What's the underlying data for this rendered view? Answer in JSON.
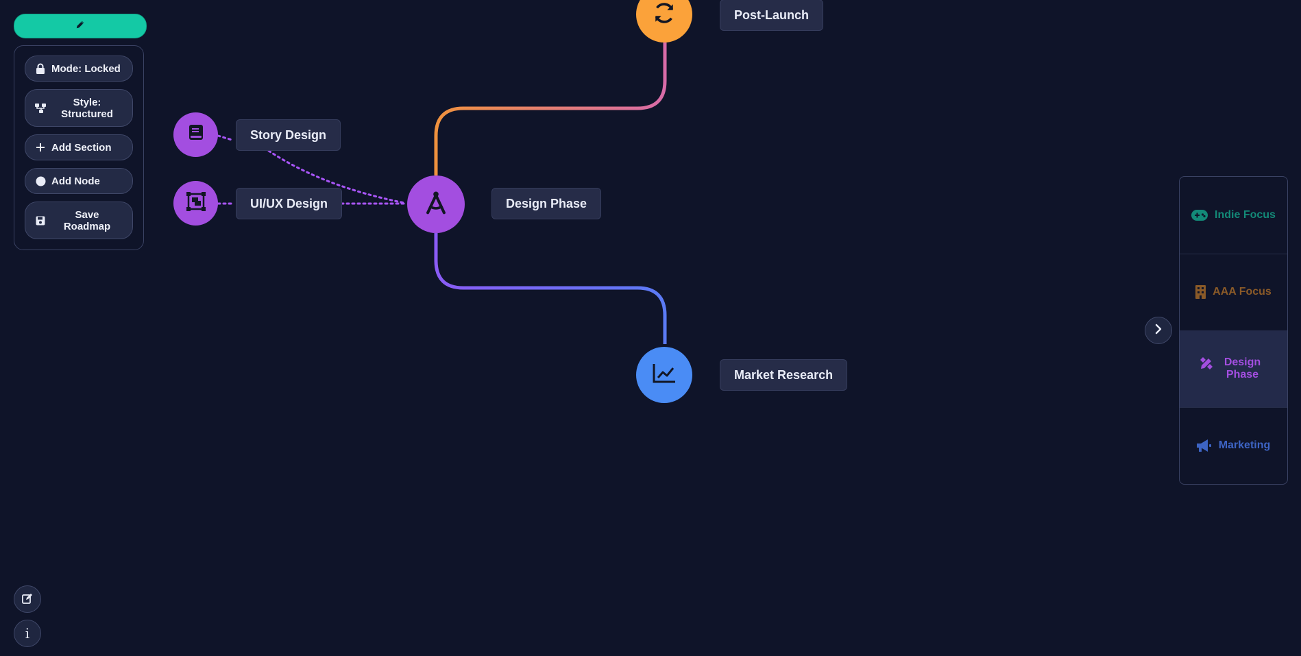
{
  "toolbar": {
    "edit_icon": "pencil-icon",
    "accent": "#14c9a5",
    "buttons": [
      {
        "label": "Mode: Locked",
        "icon": "lock-icon"
      },
      {
        "label": "Style: Structured",
        "icon": "sitemap-icon"
      },
      {
        "label": "Add Section",
        "icon": "plus-icon"
      },
      {
        "label": "Add Node",
        "icon": "circle-icon"
      },
      {
        "label": "Save Roadmap",
        "icon": "save-icon"
      }
    ]
  },
  "graph": {
    "nodes": [
      {
        "id": "post-launch",
        "label": "Post-Launch",
        "icon": "refresh-icon",
        "color": "#fba23a"
      },
      {
        "id": "design-phase",
        "label": "Design Phase",
        "icon": "compass-drafting-icon",
        "color": "#a34ee0"
      },
      {
        "id": "story-design",
        "label": "Story Design",
        "icon": "book-icon",
        "color": "#a34ee0"
      },
      {
        "id": "uiux-design",
        "label": "UI/UX Design",
        "icon": "object-group-icon",
        "color": "#a34ee0"
      },
      {
        "id": "market-research",
        "label": "Market Research",
        "icon": "chart-line-icon",
        "color": "#4a8cf5"
      }
    ],
    "edge_colors": {
      "orange": "#f0923e",
      "pink": "#d86ba8",
      "violet": "#8b5cf6",
      "blue": "#5b7bf5",
      "dotted": "#a855f7"
    }
  },
  "sidebar": {
    "items": [
      {
        "label": "Indie Focus",
        "icon": "gamepad-icon",
        "color": "#138a78"
      },
      {
        "label": "AAA Focus",
        "icon": "building-icon",
        "color": "#8a5a28"
      },
      {
        "label": "Design Phase",
        "icon": "design-tools-icon",
        "color": "#a34ee0",
        "active": true
      },
      {
        "label": "Marketing",
        "icon": "megaphone-icon",
        "color": "#3d64c4"
      }
    ],
    "active_bg": "#232a4a",
    "collapse_icon": "chevron-right-icon"
  },
  "corner": {
    "edit_icon": "edit-icon",
    "info_icon": "info-icon",
    "info_glyph": "i"
  }
}
